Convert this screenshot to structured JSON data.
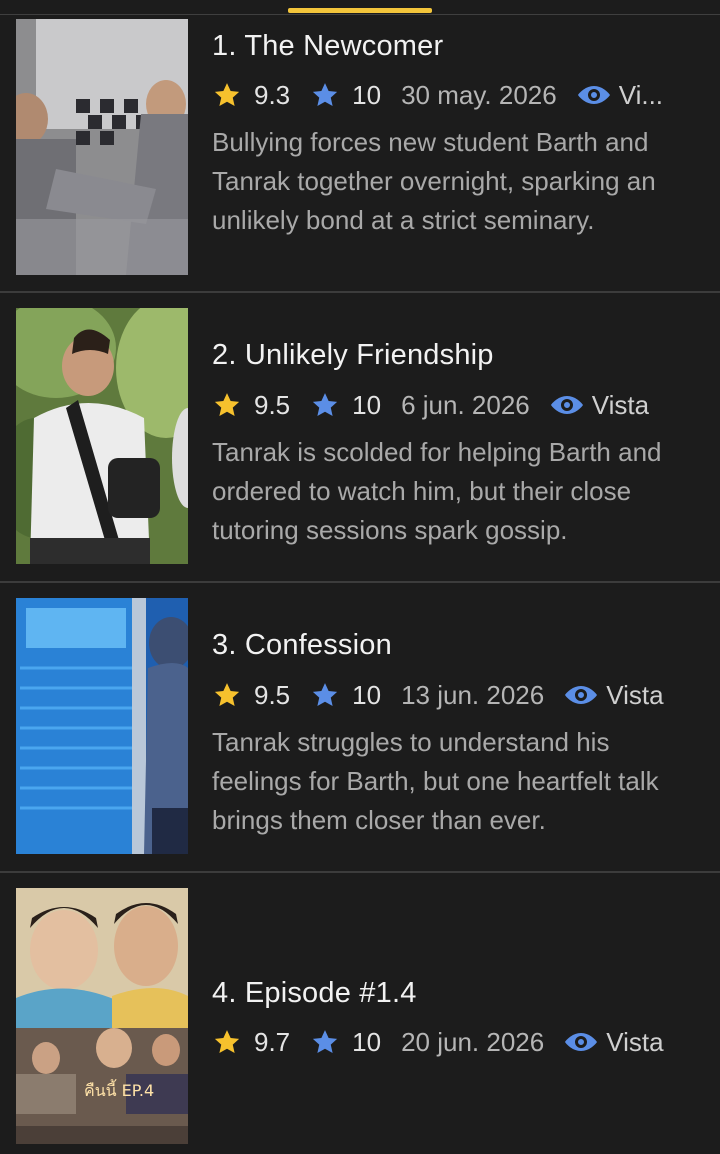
{
  "tab_indicator_color": "#f3c53b",
  "star_colors": {
    "rating": "#f6c12d",
    "user": "#5b8ee6"
  },
  "eye_color": "#5b8ee6",
  "episodes": [
    {
      "title": "1. The Newcomer",
      "rating": "9.3",
      "user_rating": "10",
      "date": "30 may. 2026",
      "view_label": "Vi...",
      "description": "Bullying forces new student Barth and Tanrak together overnight, sparking an unlikely bond at a strict seminary."
    },
    {
      "title": "2. Unlikely Friendship",
      "rating": "9.5",
      "user_rating": "10",
      "date": "6 jun. 2026",
      "view_label": "Vista",
      "description": "Tanrak is scolded for helping Barth and ordered to watch him, but their close tutoring sessions spark gossip."
    },
    {
      "title": "3. Confession",
      "rating": "9.5",
      "user_rating": "10",
      "date": "13 jun. 2026",
      "view_label": "Vista",
      "description": "Tanrak struggles to understand his feelings for Barth, but one heartfelt talk brings them closer than ever."
    },
    {
      "title": "4. Episode #1.4",
      "rating": "9.7",
      "user_rating": "10",
      "date": "20 jun. 2026",
      "view_label": "Vista",
      "description": "",
      "poster_text": "คืนนี้ EP.4"
    }
  ]
}
